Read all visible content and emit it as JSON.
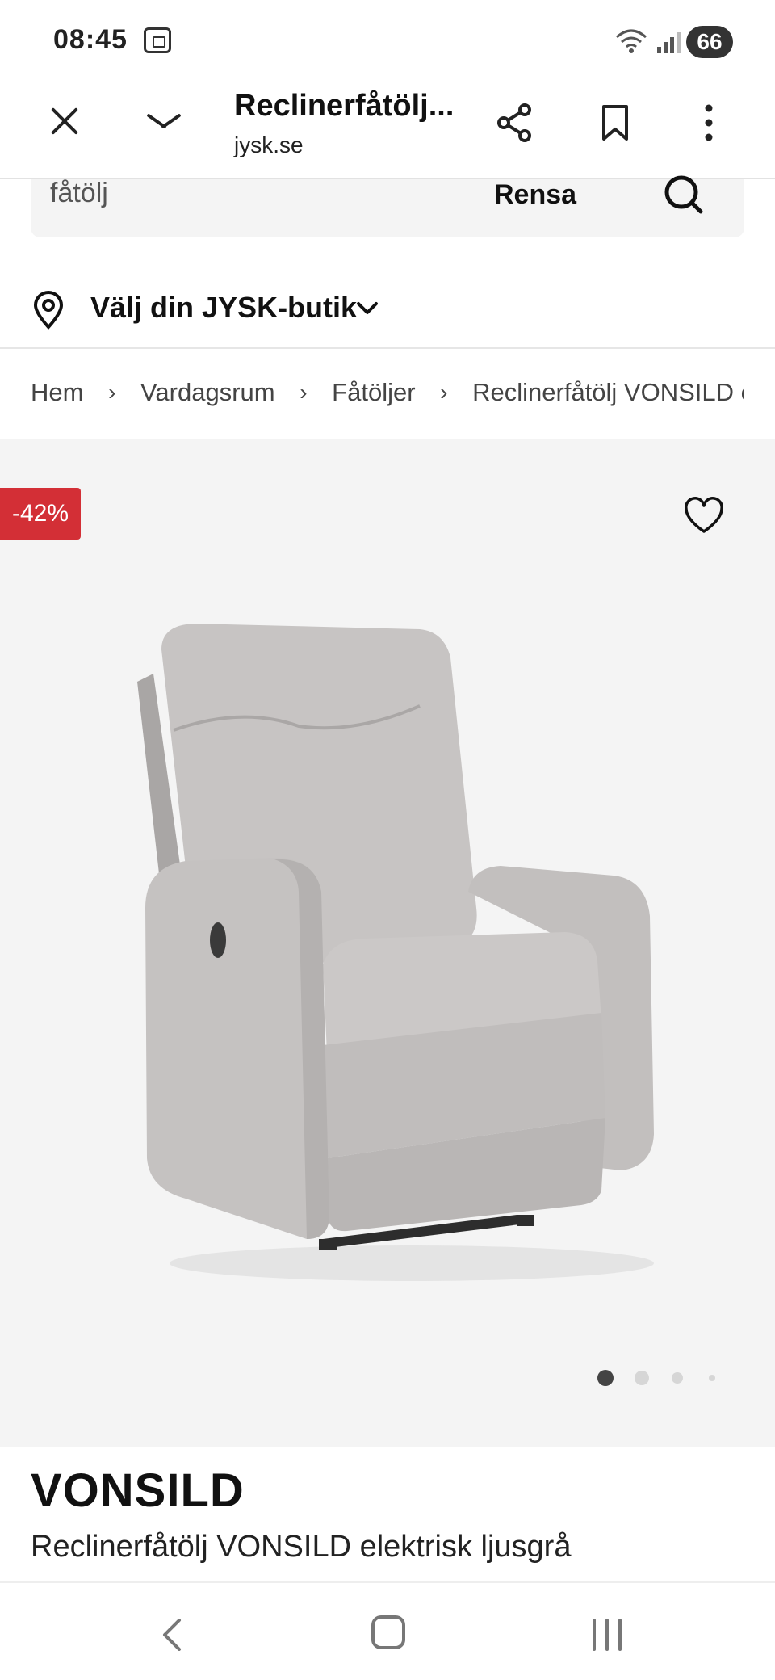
{
  "status_bar": {
    "time": "08:45",
    "battery": "66"
  },
  "browser": {
    "page_title": "Reclinerfåtölj...",
    "domain": "jysk.se"
  },
  "search": {
    "value": "fåtölj",
    "clear_label": "Rensa"
  },
  "store_selector": {
    "label": "Välj din JYSK-butik"
  },
  "breadcrumb": {
    "items": [
      "Hem",
      "Vardagsrum",
      "Fåtöljer",
      "Reclinerfåtölj VONSILD elek"
    ]
  },
  "product": {
    "discount": "-42%",
    "brand": "VONSILD",
    "name": "Reclinerfåtölj VONSILD elektrisk ljusgrå",
    "image_count": 4,
    "active_image": 1
  },
  "colors": {
    "discount_badge": "#d32f36",
    "image_background": "#f4f4f4",
    "chair_fabric": "#c4c1c0"
  },
  "icons": [
    "close-icon",
    "chevron-down-icon",
    "share-icon",
    "bookmark-icon",
    "more-vert-icon",
    "search-icon",
    "location-pin-icon",
    "heart-icon",
    "back-icon",
    "home-icon",
    "recent-apps-icon"
  ]
}
